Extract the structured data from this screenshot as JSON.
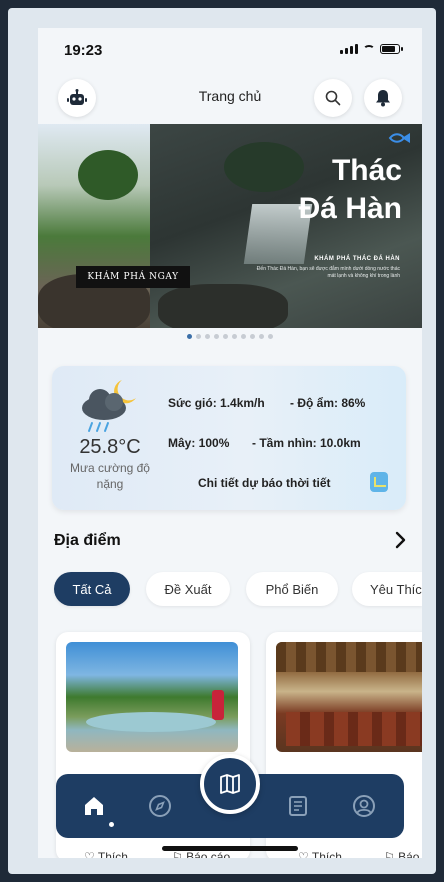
{
  "status": {
    "time": "19:23"
  },
  "header": {
    "title": "Trang chủ"
  },
  "banner": {
    "title_line1": "Thác",
    "title_line2": "Đá Hàn",
    "subtitle": "KHÁM PHÁ THÁC ĐÁ HÀN",
    "description": "Đến Thác Đá Hàn, bạn sẽ được đắm mình dưới dòng nước thác mát lạnh và không khí trong lành",
    "cta": "KHÁM PHÁ NGAY",
    "slides": 10,
    "active_slide": 0
  },
  "weather": {
    "temperature": "25.8°C",
    "description": "Mưa cường độ nặng",
    "wind": "Sức gió: 1.4km/h",
    "humidity": "- Độ ẩm: 86%",
    "cloud": "Mây: 100%",
    "visibility": "- Tầm nhìn: 10.0km",
    "detail_link": "Chi tiết dự báo thời tiết"
  },
  "places": {
    "title": "Địa điểm",
    "filters": [
      "Tất Cả",
      "Đề Xuất",
      "Phổ Biến",
      "Yêu Thíc"
    ],
    "active_filter": 0,
    "cards": [
      {
        "like": "♡ Thích",
        "report": "⚐ Báo cáo"
      },
      {
        "like": "♡ Thích",
        "report": "⚐ Báo"
      }
    ]
  },
  "nav": {
    "items": [
      "home-icon",
      "compass-icon",
      "map-icon",
      "news-icon",
      "profile-icon"
    ],
    "active": 0
  },
  "colors": {
    "primary": "#1e3d63",
    "accent": "#3b6fa8"
  }
}
